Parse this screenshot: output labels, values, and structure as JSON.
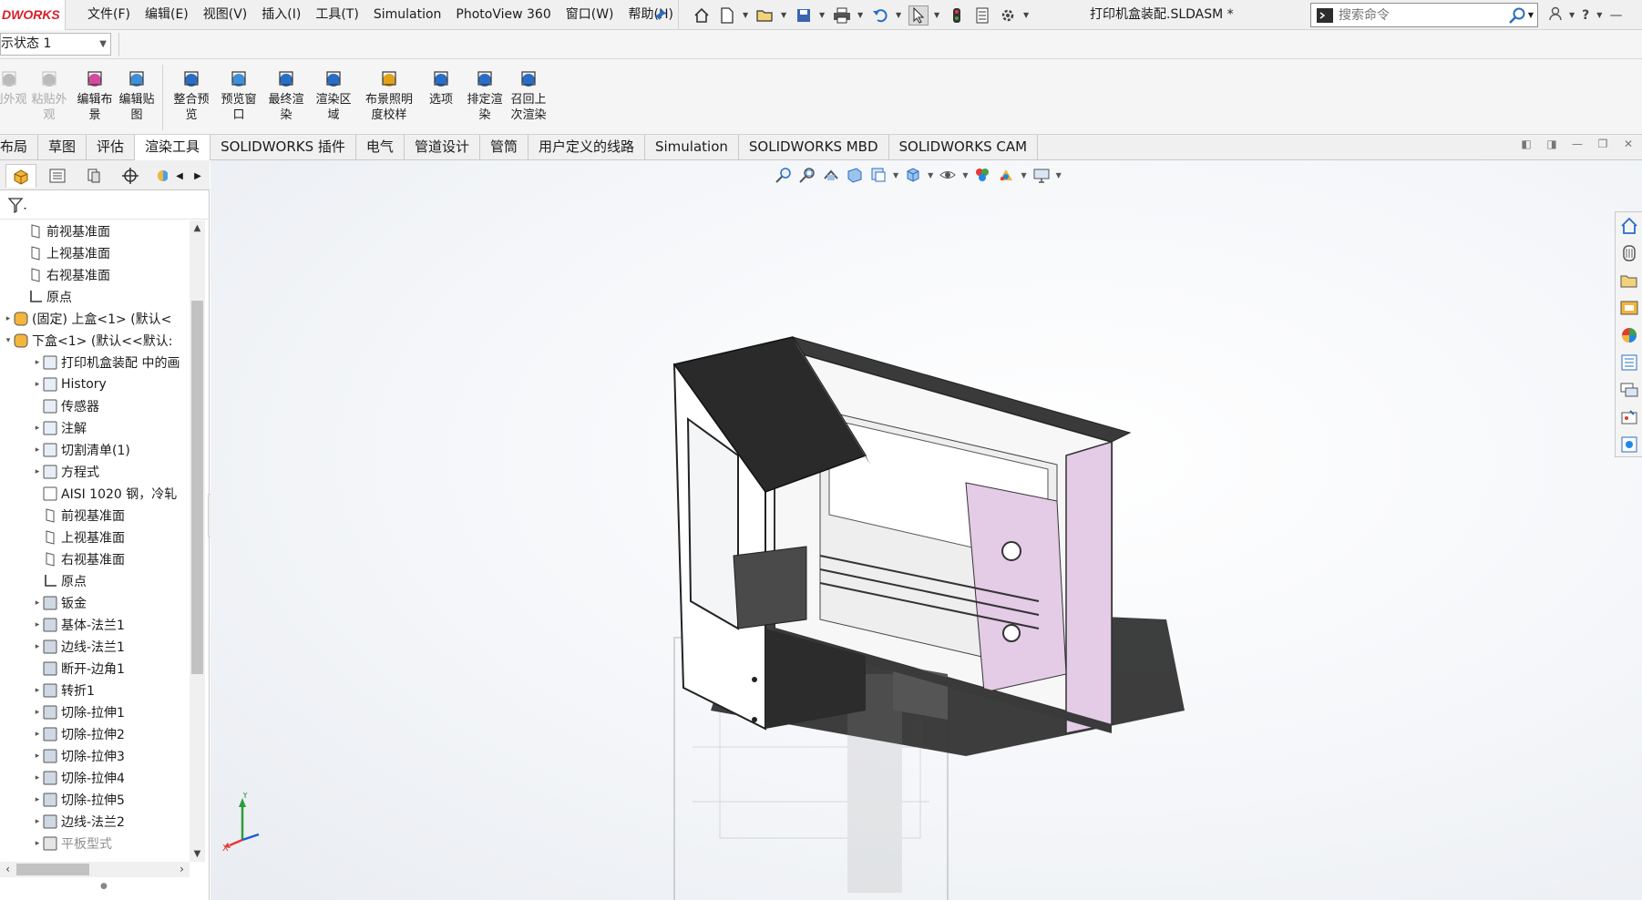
{
  "app": {
    "brand": "DWORKS",
    "document_title": "打印机盒装配.SLDASM *"
  },
  "menu": [
    "文件(F)",
    "编辑(E)",
    "视图(V)",
    "插入(I)",
    "工具(T)",
    "Simulation",
    "PhotoView 360",
    "窗口(W)",
    "帮助(H)"
  ],
  "search": {
    "placeholder": "搜索命令"
  },
  "config": {
    "selected": "示状态 1"
  },
  "ribbon": {
    "buttons": [
      {
        "label": "剔外观",
        "icon": "copy-appearance-icon",
        "disabled": true
      },
      {
        "label": "粘贴外观",
        "icon": "paste-appearance-icon",
        "disabled": true
      },
      {
        "label": "编辑布景",
        "icon": "edit-scene-icon",
        "disabled": false
      },
      {
        "label": "编辑贴图",
        "icon": "edit-decal-icon",
        "disabled": false
      },
      {
        "label": "整合预览",
        "icon": "integrated-preview-icon",
        "disabled": false
      },
      {
        "label": "预览窗口",
        "icon": "preview-window-icon",
        "disabled": false
      },
      {
        "label": "最终渲染",
        "icon": "final-render-icon",
        "disabled": false
      },
      {
        "label": "渲染区域",
        "icon": "render-region-icon",
        "disabled": false
      },
      {
        "label": "布景照明度校样",
        "icon": "scene-illumination-icon",
        "disabled": false
      },
      {
        "label": "选项",
        "icon": "options-icon",
        "disabled": false
      },
      {
        "label": "排定渲染",
        "icon": "schedule-render-icon",
        "disabled": false
      },
      {
        "label": "召回上次渲染",
        "icon": "recall-render-icon",
        "disabled": false
      }
    ]
  },
  "tabs": [
    {
      "label": "布局",
      "active": false
    },
    {
      "label": "草图",
      "active": false
    },
    {
      "label": "评估",
      "active": false
    },
    {
      "label": "渲染工具",
      "active": true
    },
    {
      "label": "SOLIDWORKS 插件",
      "active": false
    },
    {
      "label": "电气",
      "active": false
    },
    {
      "label": "管道设计",
      "active": false
    },
    {
      "label": "管筒",
      "active": false
    },
    {
      "label": "用户定义的线路",
      "active": false
    },
    {
      "label": "Simulation",
      "active": false
    },
    {
      "label": "SOLIDWORKS MBD",
      "active": false
    },
    {
      "label": "SOLIDWORKS CAM",
      "active": false
    }
  ],
  "tree": [
    {
      "label": "前视基准面",
      "icon": "plane-icon",
      "indent": 1,
      "expander": ""
    },
    {
      "label": "上视基准面",
      "icon": "plane-icon",
      "indent": 1,
      "expander": ""
    },
    {
      "label": "右视基准面",
      "icon": "plane-icon",
      "indent": 1,
      "expander": ""
    },
    {
      "label": "原点",
      "icon": "origin-icon",
      "indent": 1,
      "expander": ""
    },
    {
      "label": "(固定) 上盒<1> (默认<",
      "icon": "part-icon",
      "indent": 0,
      "expander": "▸"
    },
    {
      "label": "下盒<1> (默认<<默认:",
      "icon": "part-icon",
      "indent": 0,
      "expander": "▾"
    },
    {
      "label": "打印机盒装配 中的画",
      "icon": "drawing-ref-icon",
      "indent": 2,
      "expander": "▸"
    },
    {
      "label": "History",
      "icon": "history-icon",
      "indent": 2,
      "expander": "▸"
    },
    {
      "label": "传感器",
      "icon": "sensor-icon",
      "indent": 2,
      "expander": ""
    },
    {
      "label": "注解",
      "icon": "annotation-icon",
      "indent": 2,
      "expander": "▸"
    },
    {
      "label": "切割清单(1)",
      "icon": "cut-list-icon",
      "indent": 2,
      "expander": "▸"
    },
    {
      "label": "方程式",
      "icon": "equation-icon",
      "indent": 2,
      "expander": "▸"
    },
    {
      "label": "AISI 1020 钢，冷轧",
      "icon": "material-icon",
      "indent": 2,
      "expander": ""
    },
    {
      "label": "前视基准面",
      "icon": "plane-icon",
      "indent": 2,
      "expander": ""
    },
    {
      "label": "上视基准面",
      "icon": "plane-icon",
      "indent": 2,
      "expander": ""
    },
    {
      "label": "右视基准面",
      "icon": "plane-icon",
      "indent": 2,
      "expander": ""
    },
    {
      "label": "原点",
      "icon": "origin-icon",
      "indent": 2,
      "expander": ""
    },
    {
      "label": "钣金",
      "icon": "sheet-metal-icon",
      "indent": 2,
      "expander": "▸"
    },
    {
      "label": "基体-法兰1",
      "icon": "base-flange-icon",
      "indent": 2,
      "expander": "▸"
    },
    {
      "label": "边线-法兰1",
      "icon": "edge-flange-icon",
      "indent": 2,
      "expander": "▸"
    },
    {
      "label": "断开-边角1",
      "icon": "break-corner-icon",
      "indent": 2,
      "expander": ""
    },
    {
      "label": "转折1",
      "icon": "jog-icon",
      "indent": 2,
      "expander": "▸"
    },
    {
      "label": "切除-拉伸1",
      "icon": "cut-extrude-icon",
      "indent": 2,
      "expander": "▸"
    },
    {
      "label": "切除-拉伸2",
      "icon": "cut-extrude-icon",
      "indent": 2,
      "expander": "▸"
    },
    {
      "label": "切除-拉伸3",
      "icon": "cut-extrude-icon",
      "indent": 2,
      "expander": "▸"
    },
    {
      "label": "切除-拉伸4",
      "icon": "cut-extrude-icon",
      "indent": 2,
      "expander": "▸"
    },
    {
      "label": "切除-拉伸5",
      "icon": "cut-extrude-icon",
      "indent": 2,
      "expander": "▸"
    },
    {
      "label": "边线-法兰2",
      "icon": "edge-flange-icon",
      "indent": 2,
      "expander": "▸"
    },
    {
      "label": "平板型式",
      "icon": "flat-pattern-icon",
      "indent": 2,
      "expander": "▸",
      "dim": true
    }
  ],
  "triad": {
    "y": "Y",
    "x": "X"
  },
  "colors": {
    "accent": "#2a6dc4",
    "brand": "#d81e2a",
    "part_pink": "#e4cbe6",
    "panel_black": "#2a2a2a"
  }
}
